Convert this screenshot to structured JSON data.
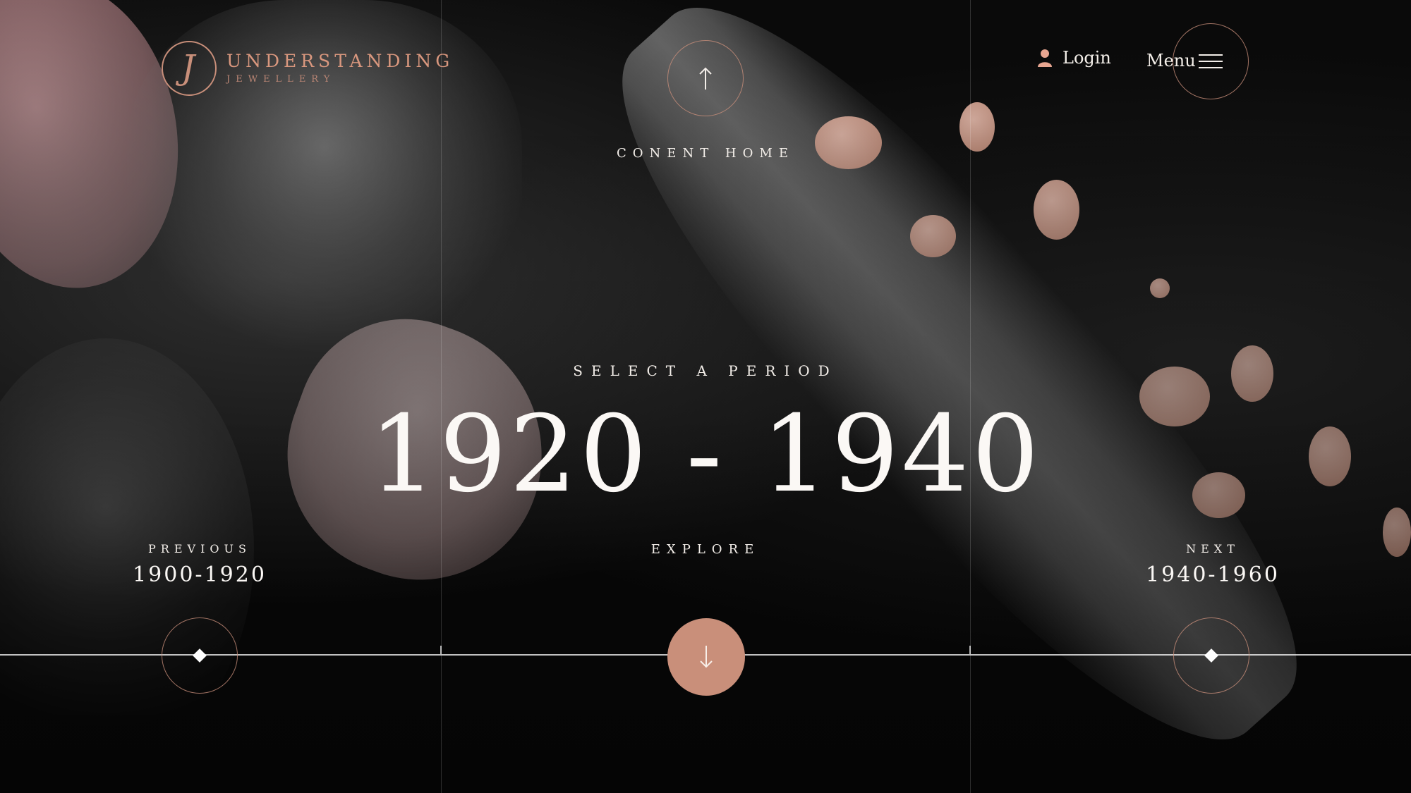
{
  "brand": {
    "title": "UNDERSTANDING",
    "subtitle": "JEWELLERY",
    "mark": "J"
  },
  "header": {
    "login_label": "Login",
    "menu_label": "Menu"
  },
  "nav": {
    "up_label": "CONENT HOME"
  },
  "main": {
    "select_label": "SELECT A PERIOD",
    "period": "1920 - 1940",
    "explore_label": "EXPLORE"
  },
  "previous": {
    "label": "PREVIOUS",
    "period": "1900-1920"
  },
  "next": {
    "label": "NEXT",
    "period": "1940-1960"
  },
  "colors": {
    "accent": "#c98f7a",
    "background": "#0b0b0b",
    "text": "#f3eee9"
  },
  "icons": {
    "user": "user-icon",
    "menu": "hamburger-icon",
    "up": "arrow-up-icon",
    "down": "arrow-down-icon",
    "marker": "diamond-icon"
  }
}
